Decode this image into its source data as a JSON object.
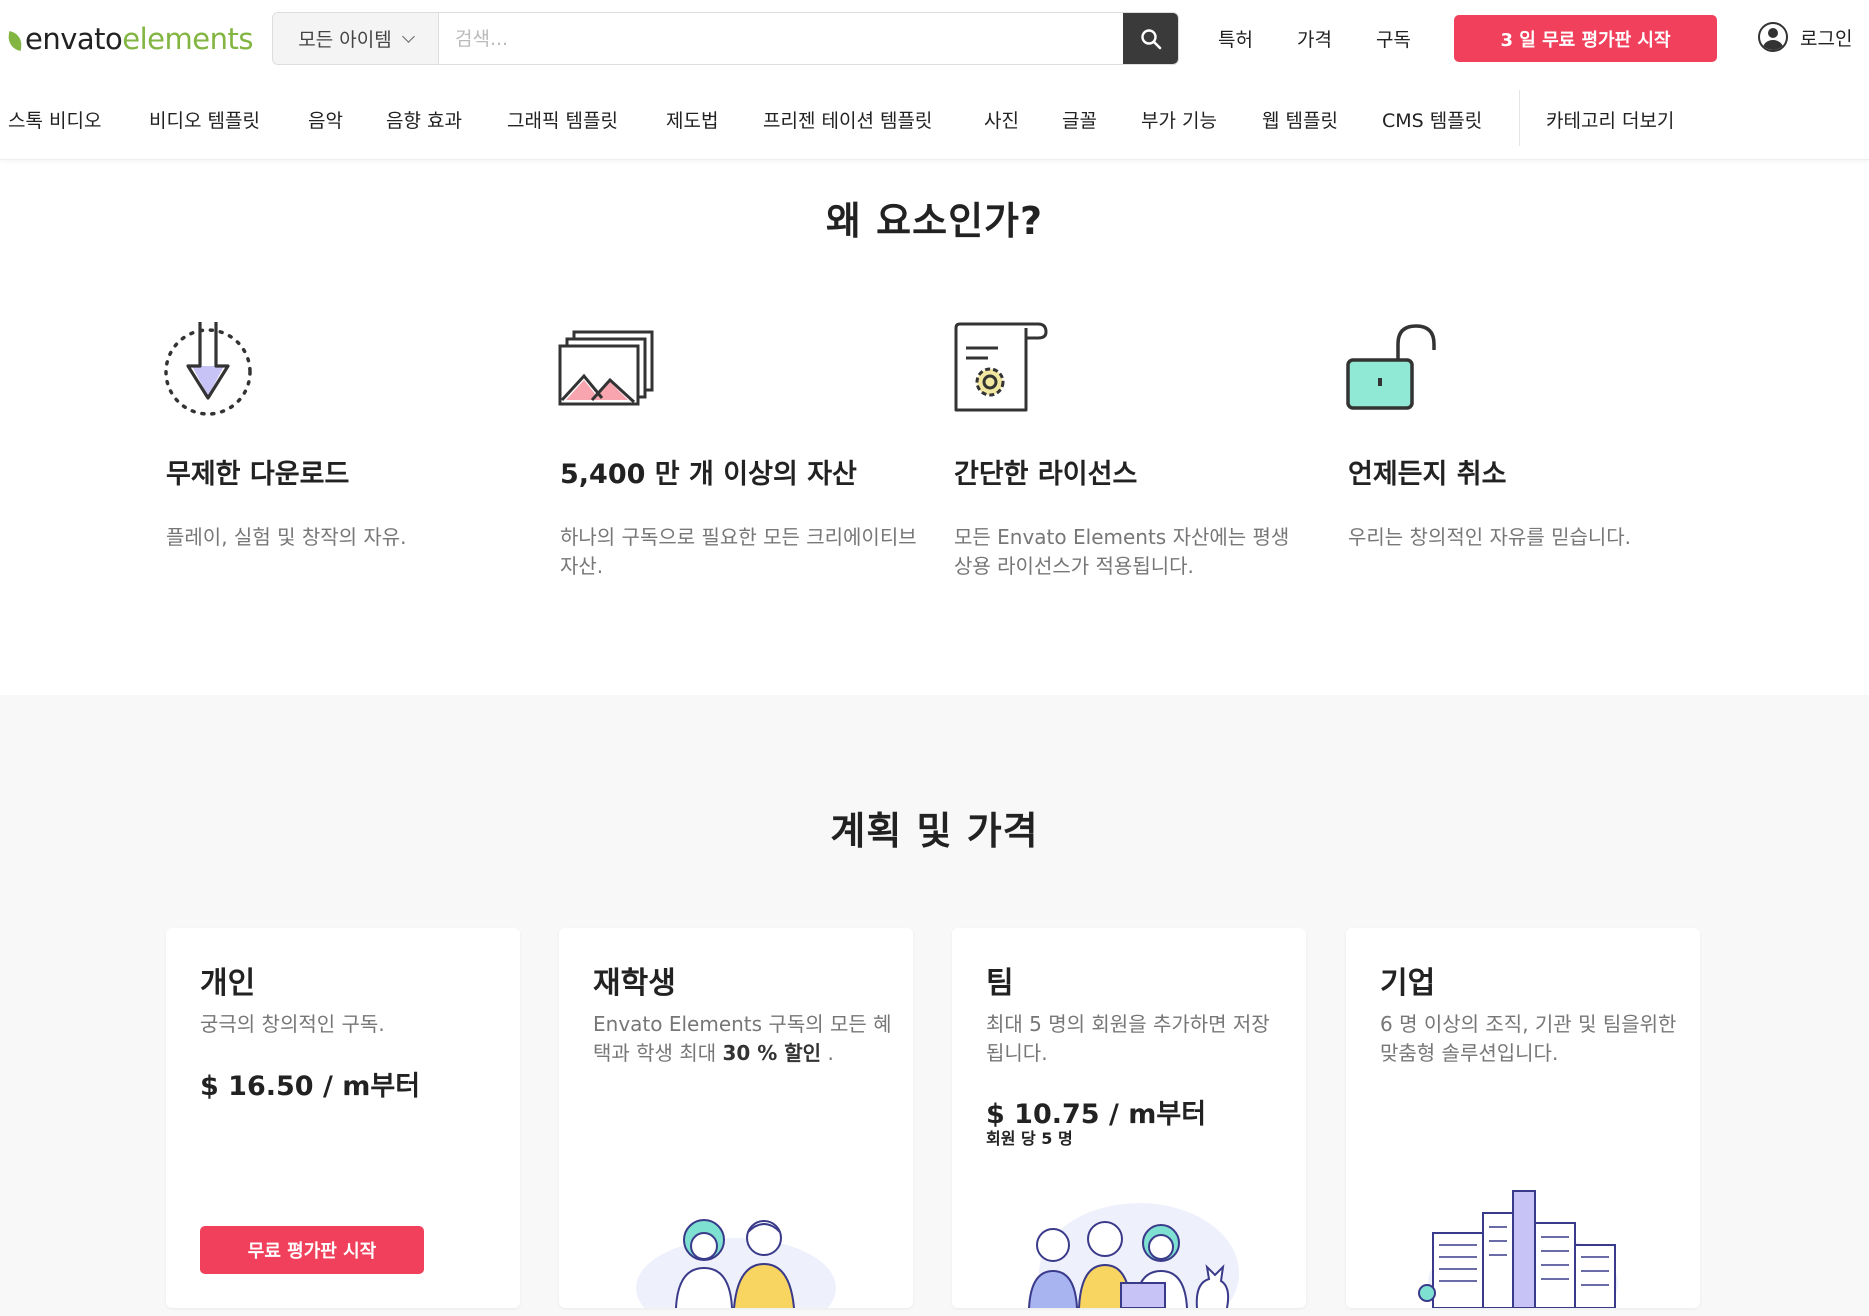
{
  "header": {
    "logo_envato": "envato",
    "logo_elements": "elements",
    "search_category": "모든 아이템",
    "search_placeholder": "검색...",
    "nav": [
      "특허",
      "가격",
      "구독"
    ],
    "cta": "3 일 무료 평가판 시작",
    "login": "로그인"
  },
  "categories": [
    "스톡 비디오",
    "비디오 템플릿",
    "음악",
    "음향 효과",
    "그래픽 템플릿",
    "제도법",
    "프리젠 테이션 템플릿",
    "사진",
    "글꼴",
    "부가 기능",
    "웹 템플릿",
    "CMS 템플릿",
    "카테고리 더보기"
  ],
  "why": {
    "title": "왜 요소인가?",
    "features": [
      {
        "icon": "download-icon",
        "title": "무제한 다운로드",
        "desc": "플레이, 실험 및 창작의 자유."
      },
      {
        "icon": "images-stack-icon",
        "title": "5,400 만 개 이상의 자산",
        "desc": "하나의 구독으로 필요한 모든 크리에이티브 자산."
      },
      {
        "icon": "certificate-icon",
        "title": "간단한 라이선스",
        "desc": "모든 Envato Elements 자산에는 평생 상용 라이선스가 적용됩니다."
      },
      {
        "icon": "unlocked-padlock-icon",
        "title": "언제든지 취소",
        "desc": "우리는 창의적인 자유를 믿습니다."
      }
    ]
  },
  "plans": {
    "title": "계획 및 가격",
    "cards": [
      {
        "title": "개인",
        "desc": "궁극의 창의적인 구독.",
        "price": "$ 16.50 / m부터",
        "button": "무료 평가판 시작"
      },
      {
        "title": "재학생",
        "desc_pre": "Envato Elements 구독의 모든 혜택과 학생 최대 ",
        "desc_bold": "30 % 할인",
        "desc_post": " ."
      },
      {
        "title": "팀",
        "desc": "최대 5 명의 회원을 추가하면 저장됩니다.",
        "price": "$ 10.75 / m부터",
        "sub": "회원 당 5 명"
      },
      {
        "title": "기업",
        "desc": "6 명 이상의 조직, 기관 및 팀을위한 맞춤형 솔루션입니다."
      }
    ]
  },
  "colors": {
    "accent": "#f0405b",
    "brand_green": "#82b541"
  }
}
